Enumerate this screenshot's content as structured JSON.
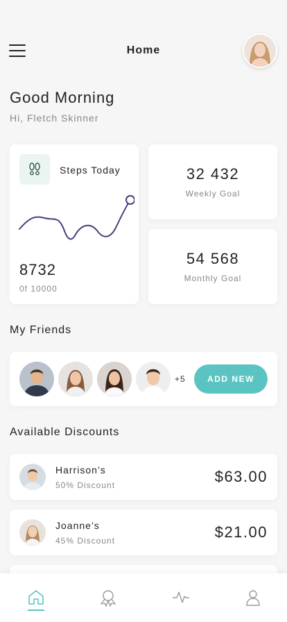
{
  "header": {
    "title": "Home"
  },
  "greeting": {
    "title": "Good Morning",
    "subtitle": "Hi, Fletch Skinner"
  },
  "steps": {
    "title": "Steps Today",
    "value": "8732",
    "subtitle": "0f 10000",
    "icon": "footprints-icon",
    "accent_color": "#4a3c7a"
  },
  "goals": {
    "weekly": {
      "value": "32 432",
      "label": "Weekly Goal"
    },
    "monthly": {
      "value": "54 568",
      "label": "Monthly Goal"
    }
  },
  "friends": {
    "title": "My Friends",
    "more_count": "+5",
    "add_button": "ADD NEW"
  },
  "discounts": {
    "title": "Available Discounts",
    "items": [
      {
        "name": "Harrison’s",
        "percent": "50% Discount",
        "price": "$63.00"
      },
      {
        "name": "Joanne’s",
        "percent": "45% Discount",
        "price": "$21.00"
      }
    ]
  },
  "tabs": [
    {
      "name": "home",
      "icon": "home-icon",
      "active": true
    },
    {
      "name": "awards",
      "icon": "award-icon",
      "active": false
    },
    {
      "name": "activity",
      "icon": "activity-icon",
      "active": false
    },
    {
      "name": "profile",
      "icon": "user-icon",
      "active": false
    }
  ],
  "colors": {
    "accent": "#5bc4c2",
    "chart_line": "#4a3c7a"
  }
}
